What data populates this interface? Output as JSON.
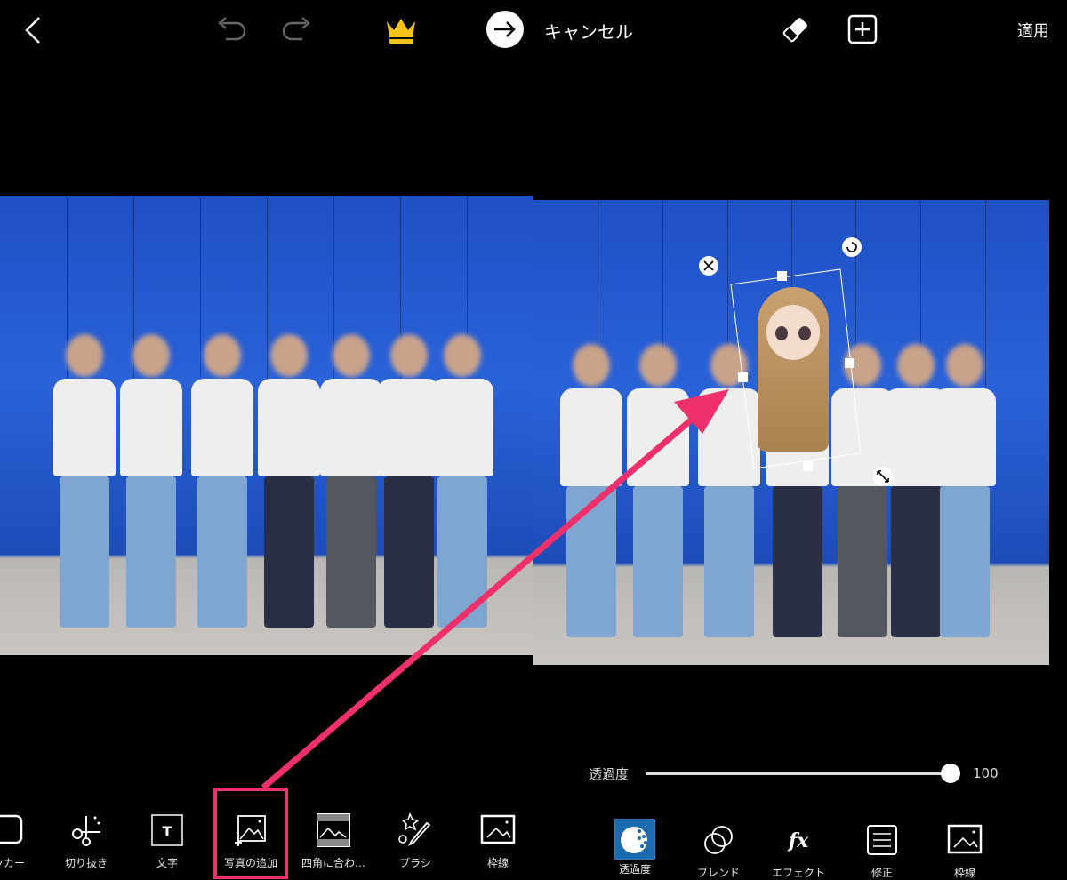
{
  "left": {
    "top_bar": {
      "icons": [
        "back-chevron-icon",
        "undo-icon",
        "redo-icon",
        "crown-icon"
      ]
    },
    "toolbar": [
      {
        "label": "ッカー",
        "icon": "sticker-icon"
      },
      {
        "label": "切り抜き",
        "icon": "cutout-scissors-icon"
      },
      {
        "label": "文字",
        "icon": "text-icon"
      },
      {
        "label": "写真の追加",
        "icon": "add-photo-icon",
        "highlighted": true
      },
      {
        "label": "四角に合わ…",
        "icon": "fit-square-icon"
      },
      {
        "label": "ブラシ",
        "icon": "brush-icon"
      },
      {
        "label": "枠線",
        "icon": "border-icon"
      }
    ]
  },
  "right": {
    "top_bar": {
      "cancel_label": "キャンセル",
      "apply_label": "適用",
      "icons": [
        "arrow-right-circle-icon",
        "eraser-icon",
        "add-square-icon"
      ]
    },
    "opacity": {
      "label": "透過度",
      "value": "100",
      "percent": 100
    },
    "toolbar": [
      {
        "label": "透過度",
        "icon": "opacity-icon",
        "selected": true
      },
      {
        "label": "ブレンド",
        "icon": "blend-icon"
      },
      {
        "label": "エフェクト",
        "icon": "fx-icon"
      },
      {
        "label": "修正",
        "icon": "adjust-icon"
      },
      {
        "label": "枠線",
        "icon": "border-icon"
      }
    ]
  },
  "colors": {
    "accent": "#f0306a",
    "selected_tool": "#1c6bb0",
    "crown": "#f7c21a",
    "wall": "#2a62d8"
  }
}
